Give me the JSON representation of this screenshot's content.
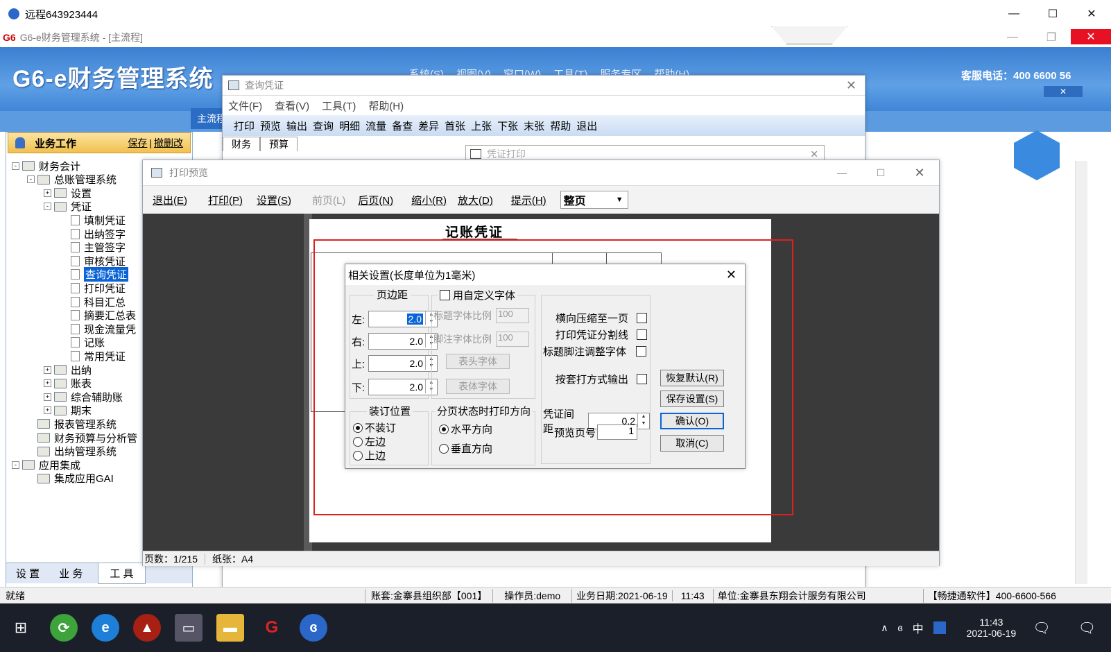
{
  "remote": {
    "title": "远程643923444"
  },
  "app": {
    "title": "G6-e财务管理系统 - [主流程]",
    "banner_title": "G6-e财务管理系统",
    "service_phone": "客服电话：400 6600 56",
    "menus": [
      "系统(S)",
      "视图(V)",
      "窗口(W)",
      "工具(T)",
      "服务专区",
      "帮助(H)"
    ],
    "main_tab": "主流程"
  },
  "left_panel": {
    "header": "业务工作",
    "header_links": [
      "保存",
      "撤删改"
    ],
    "tree": [
      {
        "label": "财务会计",
        "level": 0,
        "type": "folder",
        "pm": "-"
      },
      {
        "label": "总账管理系统",
        "level": 1,
        "type": "folder",
        "pm": "-"
      },
      {
        "label": "设置",
        "level": 2,
        "type": "folder",
        "pm": "+"
      },
      {
        "label": "凭证",
        "level": 2,
        "type": "folder",
        "pm": "-"
      },
      {
        "label": "填制凭证",
        "level": 3,
        "type": "doc"
      },
      {
        "label": "出纳签字",
        "level": 3,
        "type": "doc"
      },
      {
        "label": "主管签字",
        "level": 3,
        "type": "doc"
      },
      {
        "label": "审核凭证",
        "level": 3,
        "type": "doc"
      },
      {
        "label": "查询凭证",
        "level": 3,
        "type": "doc",
        "selected": true
      },
      {
        "label": "打印凭证",
        "level": 3,
        "type": "doc"
      },
      {
        "label": "科目汇总",
        "level": 3,
        "type": "doc"
      },
      {
        "label": "摘要汇总表",
        "level": 3,
        "type": "doc"
      },
      {
        "label": "现金流量凭",
        "level": 3,
        "type": "doc"
      },
      {
        "label": "记账",
        "level": 3,
        "type": "doc"
      },
      {
        "label": "常用凭证",
        "level": 3,
        "type": "doc"
      },
      {
        "label": "出纳",
        "level": 2,
        "type": "folder",
        "pm": "+"
      },
      {
        "label": "账表",
        "level": 2,
        "type": "folder",
        "pm": "+"
      },
      {
        "label": "综合辅助账",
        "level": 2,
        "type": "folder",
        "pm": "+"
      },
      {
        "label": "期末",
        "level": 2,
        "type": "folder",
        "pm": "+"
      },
      {
        "label": "报表管理系统",
        "level": 1,
        "type": "folder"
      },
      {
        "label": "财务预算与分析管",
        "level": 1,
        "type": "folder"
      },
      {
        "label": "出纳管理系统",
        "level": 1,
        "type": "folder"
      },
      {
        "label": "应用集成",
        "level": 0,
        "type": "folder",
        "pm": "-"
      },
      {
        "label": "集成应用GAI",
        "level": 1,
        "type": "folder"
      }
    ],
    "bottom_tabs": [
      "设 置",
      "业 务",
      "工 具"
    ]
  },
  "query_window": {
    "title": "查询凭证",
    "menus": [
      "文件(F)",
      "查看(V)",
      "工具(T)",
      "帮助(H)"
    ],
    "toolbar": [
      "打印",
      "预览",
      "输出",
      "查询",
      "明细",
      "流量",
      "备查",
      "差异",
      "首张",
      "上张",
      "下张",
      "末张",
      "帮助",
      "退出"
    ],
    "tabs": [
      "财务",
      "预算"
    ],
    "sub_title": "凭证打印"
  },
  "preview_window": {
    "title": "打印预览",
    "toolbar": [
      "退出(E)",
      "打印(P)",
      "设置(S)",
      "前页(L)",
      "后页(N)",
      "缩小(R)",
      "放大(D)",
      "提示(H)"
    ],
    "zoom_select": "整页",
    "voucher_title": "记账凭证",
    "status_pages": "页数：1/215",
    "status_paper": "纸张：A4"
  },
  "settings_dialog": {
    "title": "相关设置(长度单位为1毫米)",
    "margin_group": "页边距",
    "margins": [
      {
        "label": "左:",
        "value": "2.0"
      },
      {
        "label": "右:",
        "value": "2.0"
      },
      {
        "label": "上:",
        "value": "2.0"
      },
      {
        "label": "下:",
        "value": "2.0"
      }
    ],
    "custom_font": "用自定义字体",
    "title_font_ratio_label": "标题字体比例",
    "title_font_ratio": "100",
    "footnote_font_ratio_label": "脚注字体比例",
    "footnote_font_ratio": "100",
    "header_font_btn": "表头字体",
    "body_font_btn": "表体字体",
    "options": [
      "横向压缩至一页",
      "打印凭证分割线",
      "标题脚注调整字体",
      "按套打方式输出"
    ],
    "binding_group": "装订位置",
    "binding_options": [
      "不装订",
      "左边",
      "上边"
    ],
    "direction_group": "分页状态时打印方向",
    "direction_options": [
      "水平方向",
      "垂直方向"
    ],
    "spacing_label": "凭证间距",
    "spacing_value": "0.2",
    "preview_page_label": "预览页号",
    "preview_page_value": "1",
    "buttons": [
      "恢复默认(R)",
      "保存设置(S)",
      "确认(O)",
      "取消(C)"
    ]
  },
  "status_bar": {
    "ready": "就绪",
    "account": "账套:金寨县组织部【001】",
    "operator": "操作员:demo",
    "date": "业务日期:2021-06-19",
    "time": "11:43",
    "unit": "单位:金寨县东翔会计服务有限公司",
    "vendor": "【畅捷通软件】400-6600-566"
  },
  "taskbar": {
    "time": "11:43",
    "date": "2021-06-19",
    "ime": "中"
  },
  "colors": {
    "accent": "#3b7fd0",
    "highlight_box": "#e02020",
    "selection": "#0a64d8"
  }
}
